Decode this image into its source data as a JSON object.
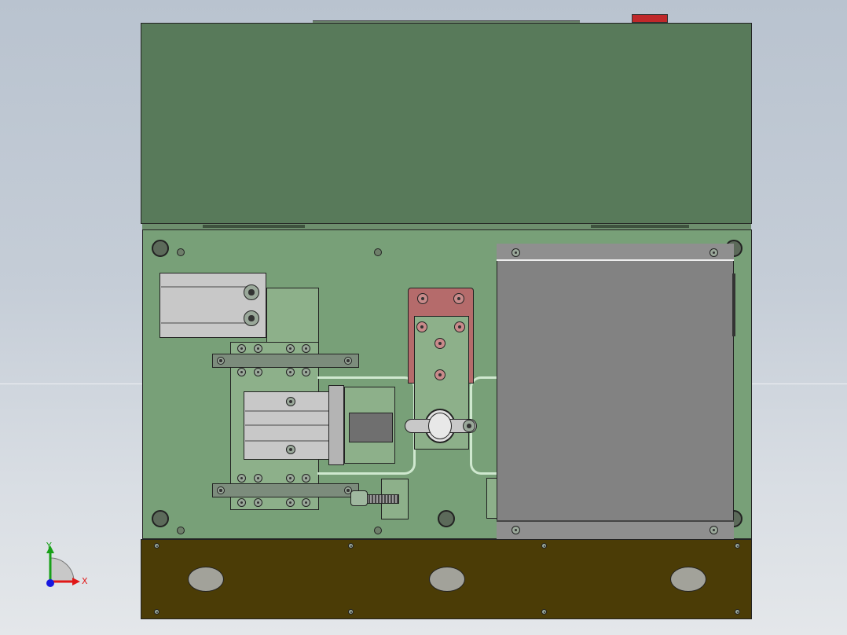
{
  "viewport": {
    "horizon_line_color": "#e6eaee"
  },
  "model": {
    "cover_panel": {
      "color": "#587a5a"
    },
    "base_plate": {
      "color": "#78a078"
    },
    "front_plate": {
      "color": "#4b3c06",
      "cutouts": 3
    },
    "motor_box": {
      "color": "#828282"
    },
    "red_bracket": {
      "color": "#b56b6b"
    },
    "tiny_red_tag": {
      "color": "#c0282a"
    },
    "brass_fitting": {
      "color": "#c89614"
    }
  },
  "triad": {
    "x_label": "X",
    "y_label": "Y",
    "x_color": "#e01818",
    "y_color": "#18a018",
    "z_color": "#1818e0"
  }
}
